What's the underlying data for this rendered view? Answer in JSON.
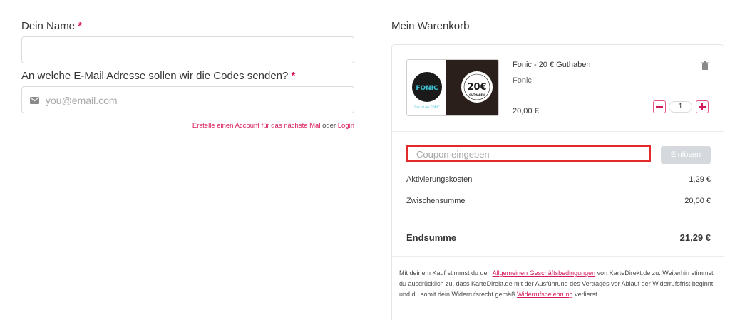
{
  "form": {
    "name_label": "Dein Name",
    "required_mark": "*",
    "name_value": "",
    "email_label": "An welche E-Mail Adresse sollen wir die Codes senden?",
    "email_placeholder": "you@email.com",
    "account_text": "Erstelle einen Account für das nächste Mal",
    "or_text": "oder",
    "login_text": "Login"
  },
  "cart": {
    "title": "Mein Warenkorb",
    "product": {
      "name": "Fonic - 20 € Guthaben",
      "brand": "Fonic",
      "price": "20,00 €",
      "quantity": "1",
      "image_logo_text": "FONIC",
      "image_value_text": "20€",
      "image_sub_text": "GUTHABEN",
      "image_tagline": "Das ist der FONIC"
    },
    "coupon_placeholder": "Coupon eingeben",
    "redeem_label": "Einlösen",
    "activation_label": "Aktivierungskosten",
    "activation_value": "1,29 €",
    "subtotal_label": "Zwischensumme",
    "subtotal_value": "20,00 €",
    "total_label": "Endsumme",
    "total_value": "21,29 €",
    "legal": {
      "part1": "Mit deinem Kauf stimmst du den ",
      "agb_link": "Allgemeinen Geschäftsbedingungen",
      "part2": " von KarteDirekt.de zu. Weiterhin stimmst du ausdrücklich zu, dass KarteDirekt.de mit der Ausführung des Vertrages vor Ablauf der Widerrufsfrist beginnt und du somit dein Widerrufsrecht gemäß ",
      "widerruf_link": "Widerrufsbelehrung",
      "part3": " verlierst."
    }
  },
  "colors": {
    "accent": "#d6185c",
    "coupon_highlight": "#e32a2a",
    "redeem_bg": "#d5d9dd",
    "fonic_teal": "#3cc0d0",
    "card_dark": "#2a1f1a"
  }
}
